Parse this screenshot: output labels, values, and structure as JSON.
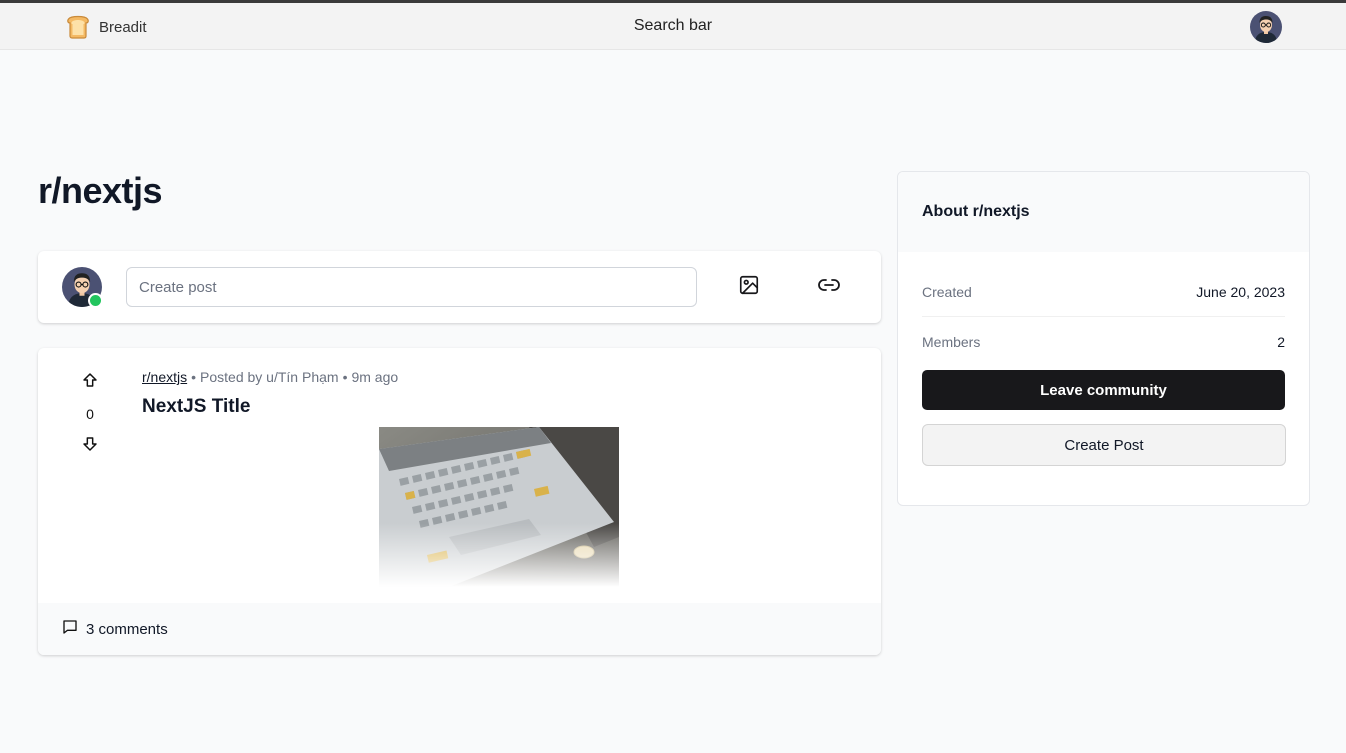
{
  "nav": {
    "brand": "Breadit",
    "brand_icon": "bread-icon",
    "search_label": "Search bar",
    "avatar_icon": "user-avatar"
  },
  "subreddit": {
    "title": "r/nextjs"
  },
  "create_post": {
    "placeholder": "Create post",
    "image_icon": "image-icon",
    "link_icon": "link-icon",
    "online_color": "#22c55e"
  },
  "post": {
    "subreddit": "r/nextjs",
    "separator": "•",
    "posted_by": "Posted by u/Tín Phạm",
    "time": "9m ago",
    "title": "NextJS Title",
    "votes": "0",
    "comments": "3 comments",
    "image_alt": "laptop keyboard photo"
  },
  "about": {
    "title": "About r/nextjs",
    "created_label": "Created",
    "created_value": "June 20, 2023",
    "members_label": "Members",
    "members_value": "2",
    "leave_label": "Leave community",
    "create_label": "Create Post"
  },
  "colors": {
    "background": "#f9fafb",
    "primary_button": "#18181b",
    "text": "#111827",
    "muted": "#6b7280"
  }
}
